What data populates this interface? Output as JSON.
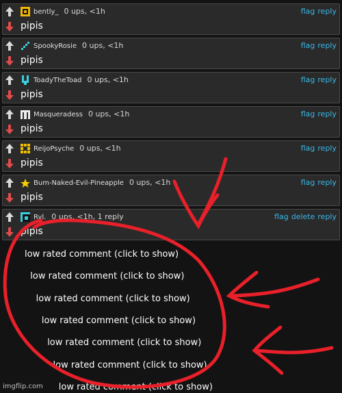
{
  "comments": [
    {
      "user": "bently_",
      "meta": "0 ups, <1h",
      "text": "pipis",
      "actions": [
        "flag",
        "reply"
      ],
      "avatar": "yellow-square-avatar-icon"
    },
    {
      "user": "SpookyRosie",
      "meta": "0 ups, <1h",
      "text": "pipis",
      "actions": [
        "flag",
        "reply"
      ],
      "avatar": "cyan-diagonal-avatar-icon"
    },
    {
      "user": "ToadyTheToad",
      "meta": "0 ups, <1h",
      "text": "pipis",
      "actions": [
        "flag",
        "reply"
      ],
      "avatar": "cyan-toad-avatar-icon"
    },
    {
      "user": "Masqueradess",
      "meta": "0 ups, <1h",
      "text": "pipis",
      "actions": [
        "flag",
        "reply"
      ],
      "avatar": "white-mask-avatar-icon"
    },
    {
      "user": "ReijoPsyche",
      "meta": "0 ups, <1h",
      "text": "pipis",
      "actions": [
        "flag",
        "reply"
      ],
      "avatar": "yellow-grid-avatar-icon"
    },
    {
      "user": "Bum-Naked-Evil-Pineapple",
      "meta": "0 ups, <1h",
      "text": "pipis",
      "actions": [
        "flag",
        "reply"
      ],
      "avatar": "yellow-star-avatar-icon"
    },
    {
      "user": "Ryl.",
      "meta": "0 ups, <1h, 1 reply",
      "text": "pipis",
      "actions": [
        "flag",
        "delete",
        "reply"
      ],
      "avatar": "cyan-frame-avatar-icon"
    }
  ],
  "low_rated_label": "low rated comment (click to show)",
  "low_rated_count": 7,
  "watermark": "imgflip.com",
  "colors": {
    "link": "#39b7e8",
    "upvote": "#d9d9d9",
    "downvote": "#e14b4b",
    "annotation": "#e8202a",
    "background": "#131313",
    "panel": "#2a2a2a"
  }
}
